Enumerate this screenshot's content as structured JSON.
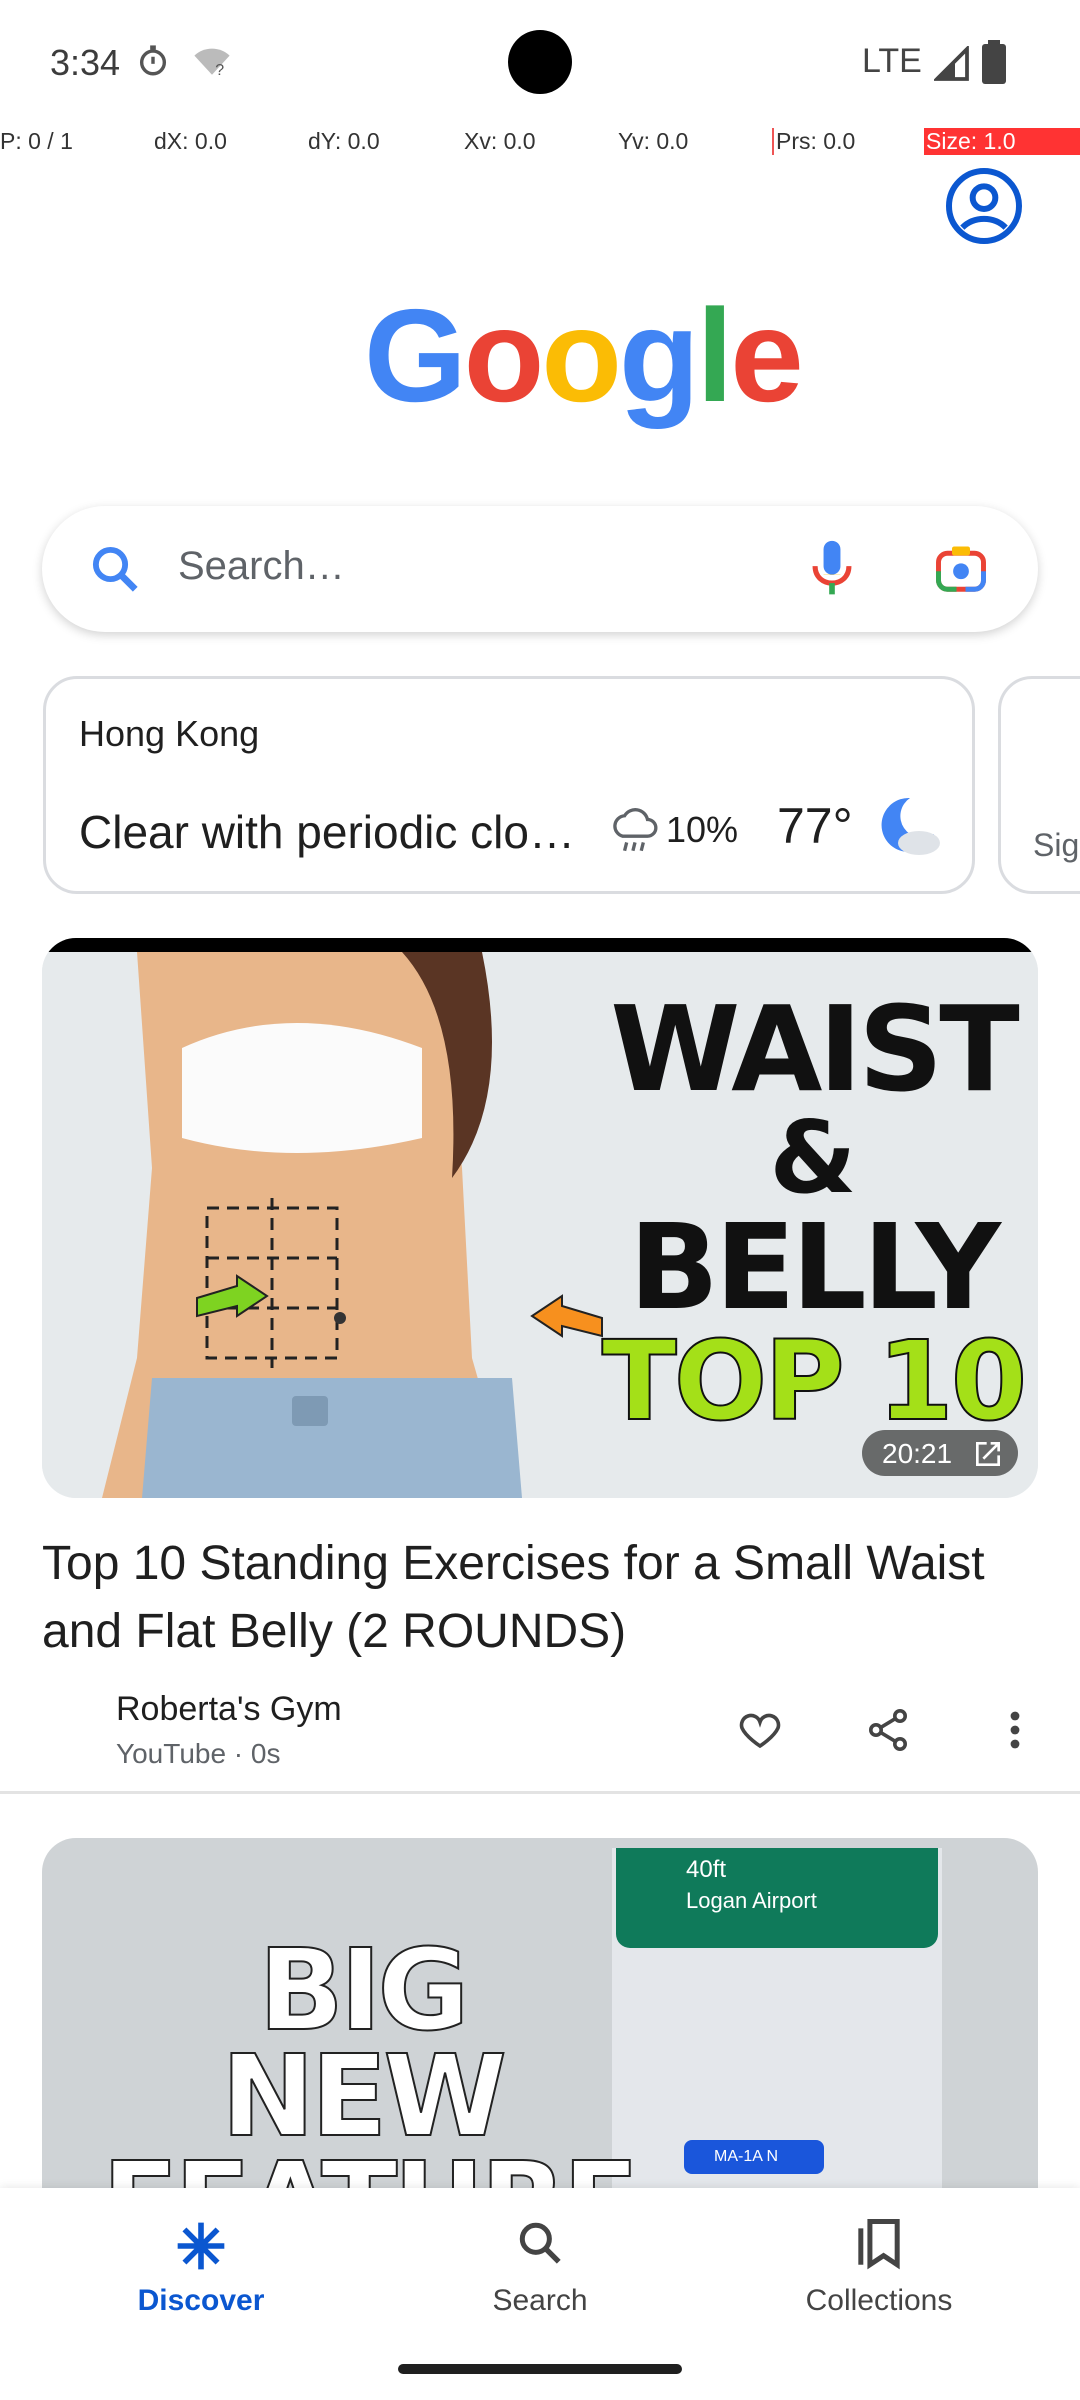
{
  "status_bar": {
    "time": "3:34",
    "network": "LTE"
  },
  "debug_overlay": [
    "P: 0 / 1",
    "dX: 0.0",
    "dY: 0.0",
    "Xv: 0.0",
    "Yv: 0.0",
    "Prs: 0.0",
    "Size: 1.0"
  ],
  "logo": {
    "text": "Google"
  },
  "search": {
    "placeholder": "Search…"
  },
  "weather": {
    "city": "Hong Kong",
    "description": "Clear with periodic clouds",
    "rain_chance": "10%",
    "temperature": "77°"
  },
  "second_card": {
    "text": "Sign"
  },
  "article1": {
    "duration": "20:21",
    "thumb_text": [
      "WAIST",
      "&",
      "BELLY",
      "TOP 10"
    ],
    "title": "Top 10 Standing Exercises for a Small Waist and Flat Belly (2 ROUNDS)",
    "source": "Roberta's Gym",
    "meta": "YouTube · 0s"
  },
  "article2": {
    "thumb_text": [
      "BIG",
      "NEW",
      "FEATURE"
    ],
    "map_label": "Logan Airport",
    "map_distance": "40ft",
    "road_label": "MA-1A N"
  },
  "bottom_nav": {
    "discover": "Discover",
    "search": "Search",
    "collections": "Collections"
  },
  "colors": {
    "accent": "#0b57d0",
    "g_blue": "#4285f4",
    "g_red": "#ea4335",
    "g_yellow": "#fbbc05",
    "g_green": "#34a853"
  }
}
